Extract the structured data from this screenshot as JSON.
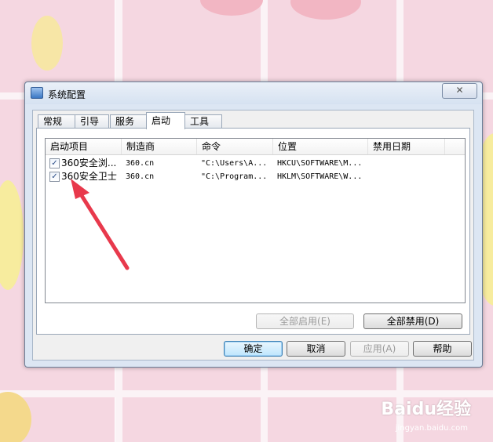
{
  "window": {
    "title": "系统配置",
    "close_glyph": "✕"
  },
  "tabs": [
    {
      "label": "常规"
    },
    {
      "label": "引导"
    },
    {
      "label": "服务"
    },
    {
      "label": "启动"
    },
    {
      "label": "工具"
    }
  ],
  "active_tab": "启动",
  "table": {
    "columns": [
      "启动项目",
      "制造商",
      "命令",
      "位置",
      "禁用日期"
    ],
    "rows": [
      {
        "checked": true,
        "name": "360安全浏...",
        "maker": "360.cn",
        "command": "\"C:\\Users\\A...",
        "location": "HKCU\\SOFTWARE\\M...",
        "disabled_date": ""
      },
      {
        "checked": true,
        "name": "360安全卫士",
        "maker": "360.cn",
        "command": "\"C:\\Program...",
        "location": "HKLM\\SOFTWARE\\W...",
        "disabled_date": ""
      }
    ]
  },
  "buttons": {
    "enable_all": "全部启用(E)",
    "disable_all": "全部禁用(D)",
    "ok": "确定",
    "cancel": "取消",
    "apply": "应用(A)",
    "help": "帮助"
  },
  "watermark": {
    "brand": "Baidu经验",
    "sub": "jingyan.baidu.com"
  },
  "colors": {
    "annotation_arrow": "#e8394c",
    "dialog_frame": "#dce6f3"
  }
}
